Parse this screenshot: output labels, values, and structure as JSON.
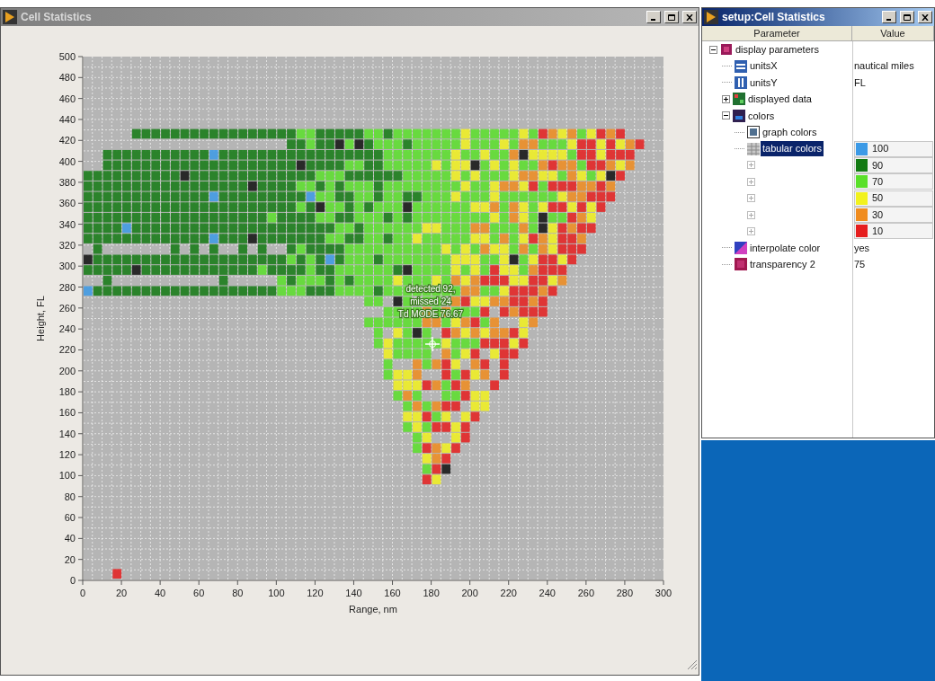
{
  "main_window": {
    "title": "Cell Statistics"
  },
  "plot": {
    "ylabel": "Height, FL",
    "xlabel": "Range, nm",
    "yticks": [
      "500",
      "480",
      "460",
      "440",
      "420",
      "400",
      "380",
      "360",
      "340",
      "320",
      "300",
      "280",
      "260",
      "240",
      "220",
      "200",
      "180",
      "160",
      "140",
      "120",
      "100",
      "80",
      "60",
      "40",
      "20",
      "0"
    ],
    "xticks": [
      "0",
      "20",
      "40",
      "60",
      "80",
      "100",
      "120",
      "140",
      "160",
      "180",
      "200",
      "220",
      "240",
      "260",
      "280",
      "300"
    ],
    "tooltip": [
      "detected 92,",
      "missed 24",
      "Td MODE 76.67"
    ]
  },
  "setup_window": {
    "title": "setup:Cell Statistics",
    "columns": [
      "Parameter",
      "Value"
    ]
  },
  "tree": [
    {
      "label": "display parameters",
      "expanded": true,
      "selected": false,
      "children": [
        {
          "label": "unitsX",
          "value": "nautical miles",
          "selected": false
        },
        {
          "label": "unitsY",
          "value": "FL",
          "selected": false
        },
        {
          "label": "displayed data",
          "expanded": false,
          "selected": false
        },
        {
          "label": "colors",
          "expanded": true,
          "selected": false,
          "children": [
            {
              "label": "graph colors",
              "selected": false
            },
            {
              "label": "tabular colors",
              "selected": true,
              "color": "#3c9ae6",
              "value": "100"
            },
            {
              "expanded": false,
              "color": "#137a13",
              "value": "90"
            },
            {
              "expanded": false,
              "color": "#5ae02a",
              "value": "70"
            },
            {
              "expanded": false,
              "color": "#f2f21e",
              "value": "50"
            },
            {
              "expanded": false,
              "color": "#f08c1e",
              "value": "30"
            },
            {
              "expanded": false,
              "color": "#e61e1e",
              "value": "10"
            }
          ]
        },
        {
          "label": "interpolate color",
          "value": "yes",
          "selected": false
        },
        {
          "label": "transparency 2",
          "value": "75",
          "selected": false
        }
      ]
    }
  ]
}
